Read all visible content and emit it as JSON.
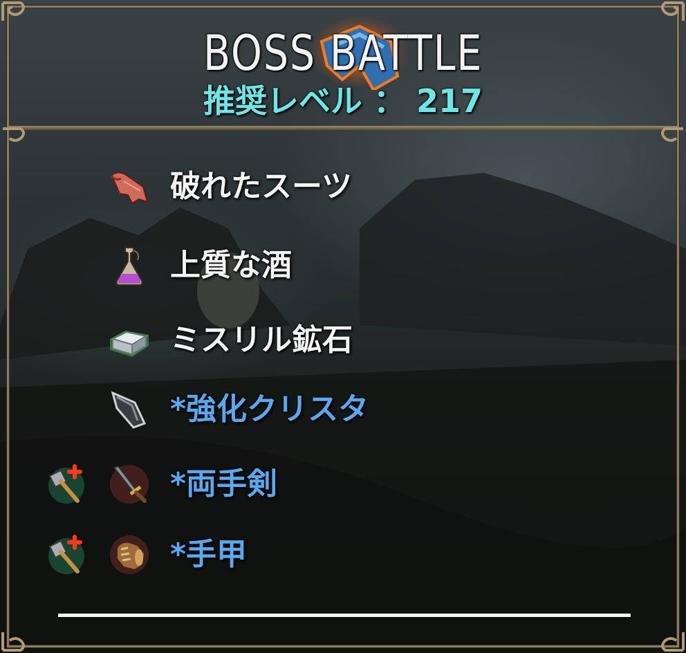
{
  "header": {
    "title": "BOSS BATTLE",
    "recommended_level_label": "推奨レベル ： 217"
  },
  "drops": [
    {
      "label": "破れたスーツ",
      "icon": "torn-cloth-icon",
      "type": "material",
      "craftable": false
    },
    {
      "label": "上質な酒",
      "icon": "potion-flask-icon",
      "type": "material",
      "craftable": false
    },
    {
      "label": "ミスリル鉱石",
      "icon": "ore-ingot-icon",
      "type": "material",
      "craftable": false
    },
    {
      "label": "*強化クリスタ",
      "icon": "crystal-icon",
      "type": "equipment",
      "craftable": false
    },
    {
      "label": "*両手剣",
      "icon": "two-handed-sword-icon",
      "type": "equipment",
      "craftable": true
    },
    {
      "label": "*手甲",
      "icon": "gauntlet-icon",
      "type": "equipment",
      "craftable": true
    }
  ],
  "colors": {
    "level_text": "#6fe6e6",
    "material_text": "#f4f4f4",
    "equipment_text": "#5aa8f0",
    "frame": "#8d7a62"
  },
  "craft_icon": "hammer-plus-icon"
}
